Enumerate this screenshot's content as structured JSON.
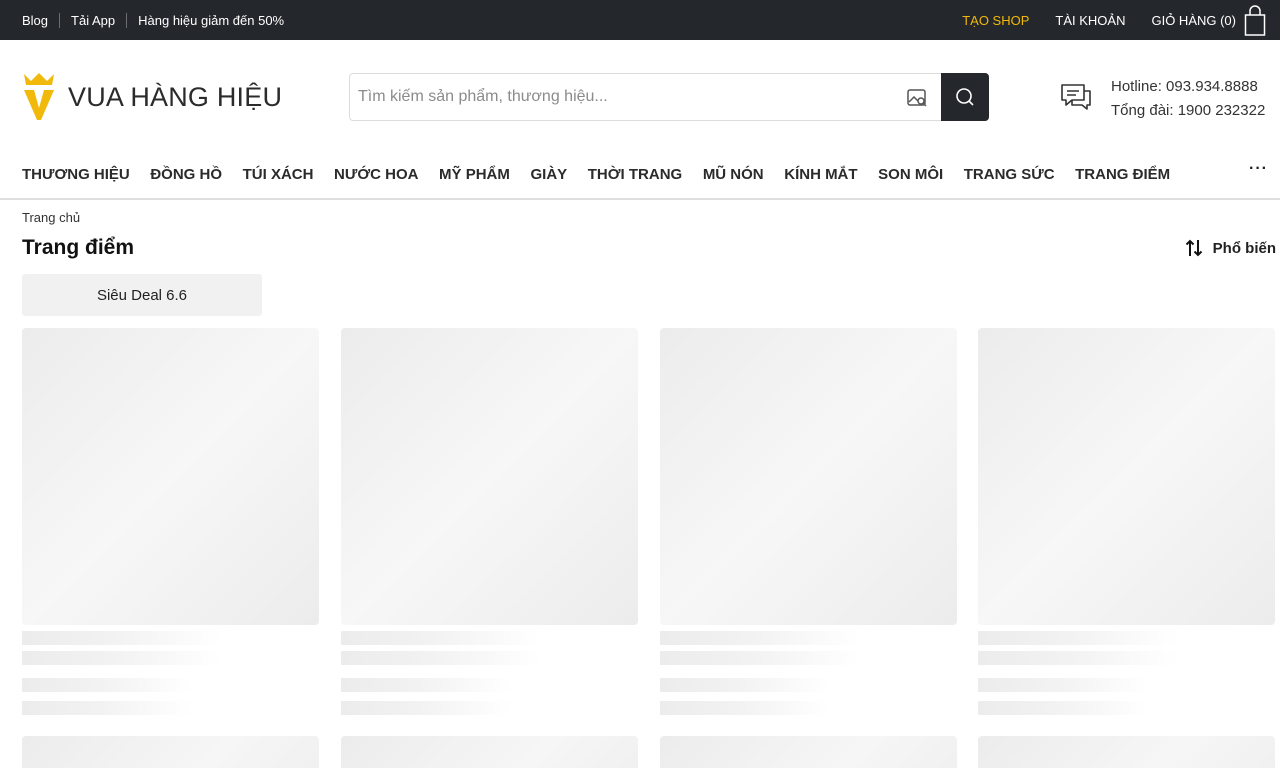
{
  "topbar": {
    "left_links": [
      "Blog",
      "Tải App",
      "Hàng hiệu giảm đến 50%"
    ],
    "create_shop": "TẠO SHOP",
    "account": "TÀI KHOẢN",
    "cart": "GIỎ HÀNG (0)",
    "bg_color": "#24272b",
    "shop_color": "#f0b90b"
  },
  "header": {
    "logo_text": "VUA HÀNG HIỆU",
    "logo_color": "#f0b90b",
    "search_placeholder": "Tìm kiếm sản phẩm, thương hiệu...",
    "hotline": "Hotline: 093.934.8888",
    "switchboard": "Tổng đài: 1900 232322"
  },
  "nav": {
    "items": [
      "THƯƠNG HIỆU",
      "ĐỒNG HỒ",
      "TÚI XÁCH",
      "NƯỚC HOA",
      "MỸ PHẨM",
      "GIÀY",
      "THỜI TRANG",
      "MŨ NÓN",
      "KÍNH MẮT",
      "SON MÔI",
      "TRANG SỨC",
      "TRANG ĐIỂM"
    ],
    "more": "···"
  },
  "content": {
    "breadcrumb": "Trang chủ",
    "title": "Trang điểm",
    "sort_label": "Phổ biến",
    "chip": "Siêu Deal 6.6"
  }
}
